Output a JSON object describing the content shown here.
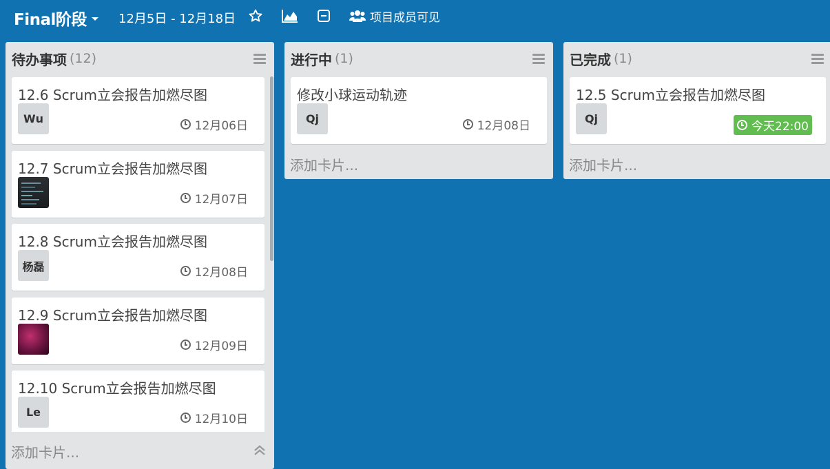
{
  "header": {
    "board_name": "Final阶段",
    "date_range": "12月5日 - 12月18日",
    "visibility_label": "项目成员可见"
  },
  "lists": [
    {
      "title": "待办事项",
      "count": "(12)",
      "add_card_label": "添加卡片...",
      "cards": [
        {
          "title": "12.6 Scrum立会报告加燃尽图",
          "avatar_text": "Wu",
          "due": "12月06日"
        },
        {
          "title": "12.7 Scrum立会报告加燃尽图",
          "avatar_text": "",
          "due": "12月07日"
        },
        {
          "title": "12.8 Scrum立会报告加燃尽图",
          "avatar_text": "杨磊",
          "due": "12月08日"
        },
        {
          "title": "12.9 Scrum立会报告加燃尽图",
          "avatar_text": "",
          "due": "12月09日"
        },
        {
          "title": "12.10 Scrum立会报告加燃尽图",
          "avatar_text": "Le",
          "due": "12月10日"
        }
      ]
    },
    {
      "title": "进行中",
      "count": "(1)",
      "add_card_label": "添加卡片...",
      "cards": [
        {
          "title": "修改小球运动轨迹",
          "avatar_text": "Qj",
          "due": "12月08日"
        }
      ]
    },
    {
      "title": "已完成",
      "count": "(1)",
      "add_card_label": "添加卡片...",
      "cards": [
        {
          "title": "12.5 Scrum立会报告加燃尽图",
          "avatar_text": "Qj",
          "due": "今天22:00",
          "due_status": "due-soon"
        }
      ]
    }
  ],
  "colors": {
    "board_background": "#1072b0",
    "list_background": "#e2e4e6",
    "due_soon": "#61bd4f"
  }
}
